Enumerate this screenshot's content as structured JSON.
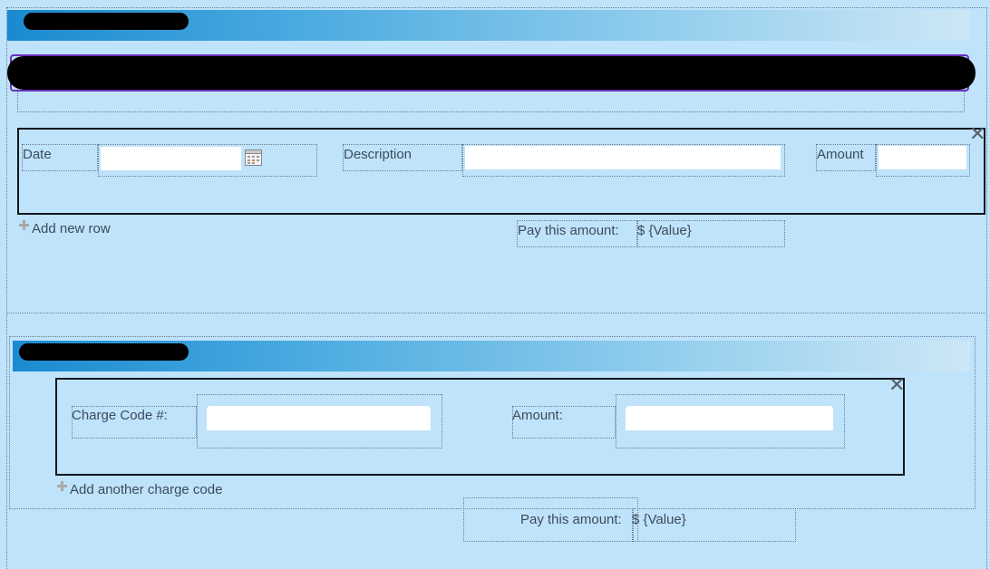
{
  "expenses": {
    "headers": {
      "date": "Date",
      "description": "Description",
      "amount": "Amount"
    },
    "add_row_label": "Add new row",
    "total_label": "Pay this amount:",
    "total_value": "$ {Value}",
    "remove_icon": "close-icon",
    "date_icon": "calendar-icon"
  },
  "charges": {
    "code_label": "Charge Code #:",
    "amount_label": "Amount:",
    "add_label": "Add another charge code",
    "total_label": "Pay this amount:",
    "total_value": "$ {Value}",
    "remove_icon": "close-icon"
  },
  "colors": {
    "background": "#bfe3fb",
    "banner_start": "#1a8ad0",
    "banner_end": "#cde7f5"
  }
}
